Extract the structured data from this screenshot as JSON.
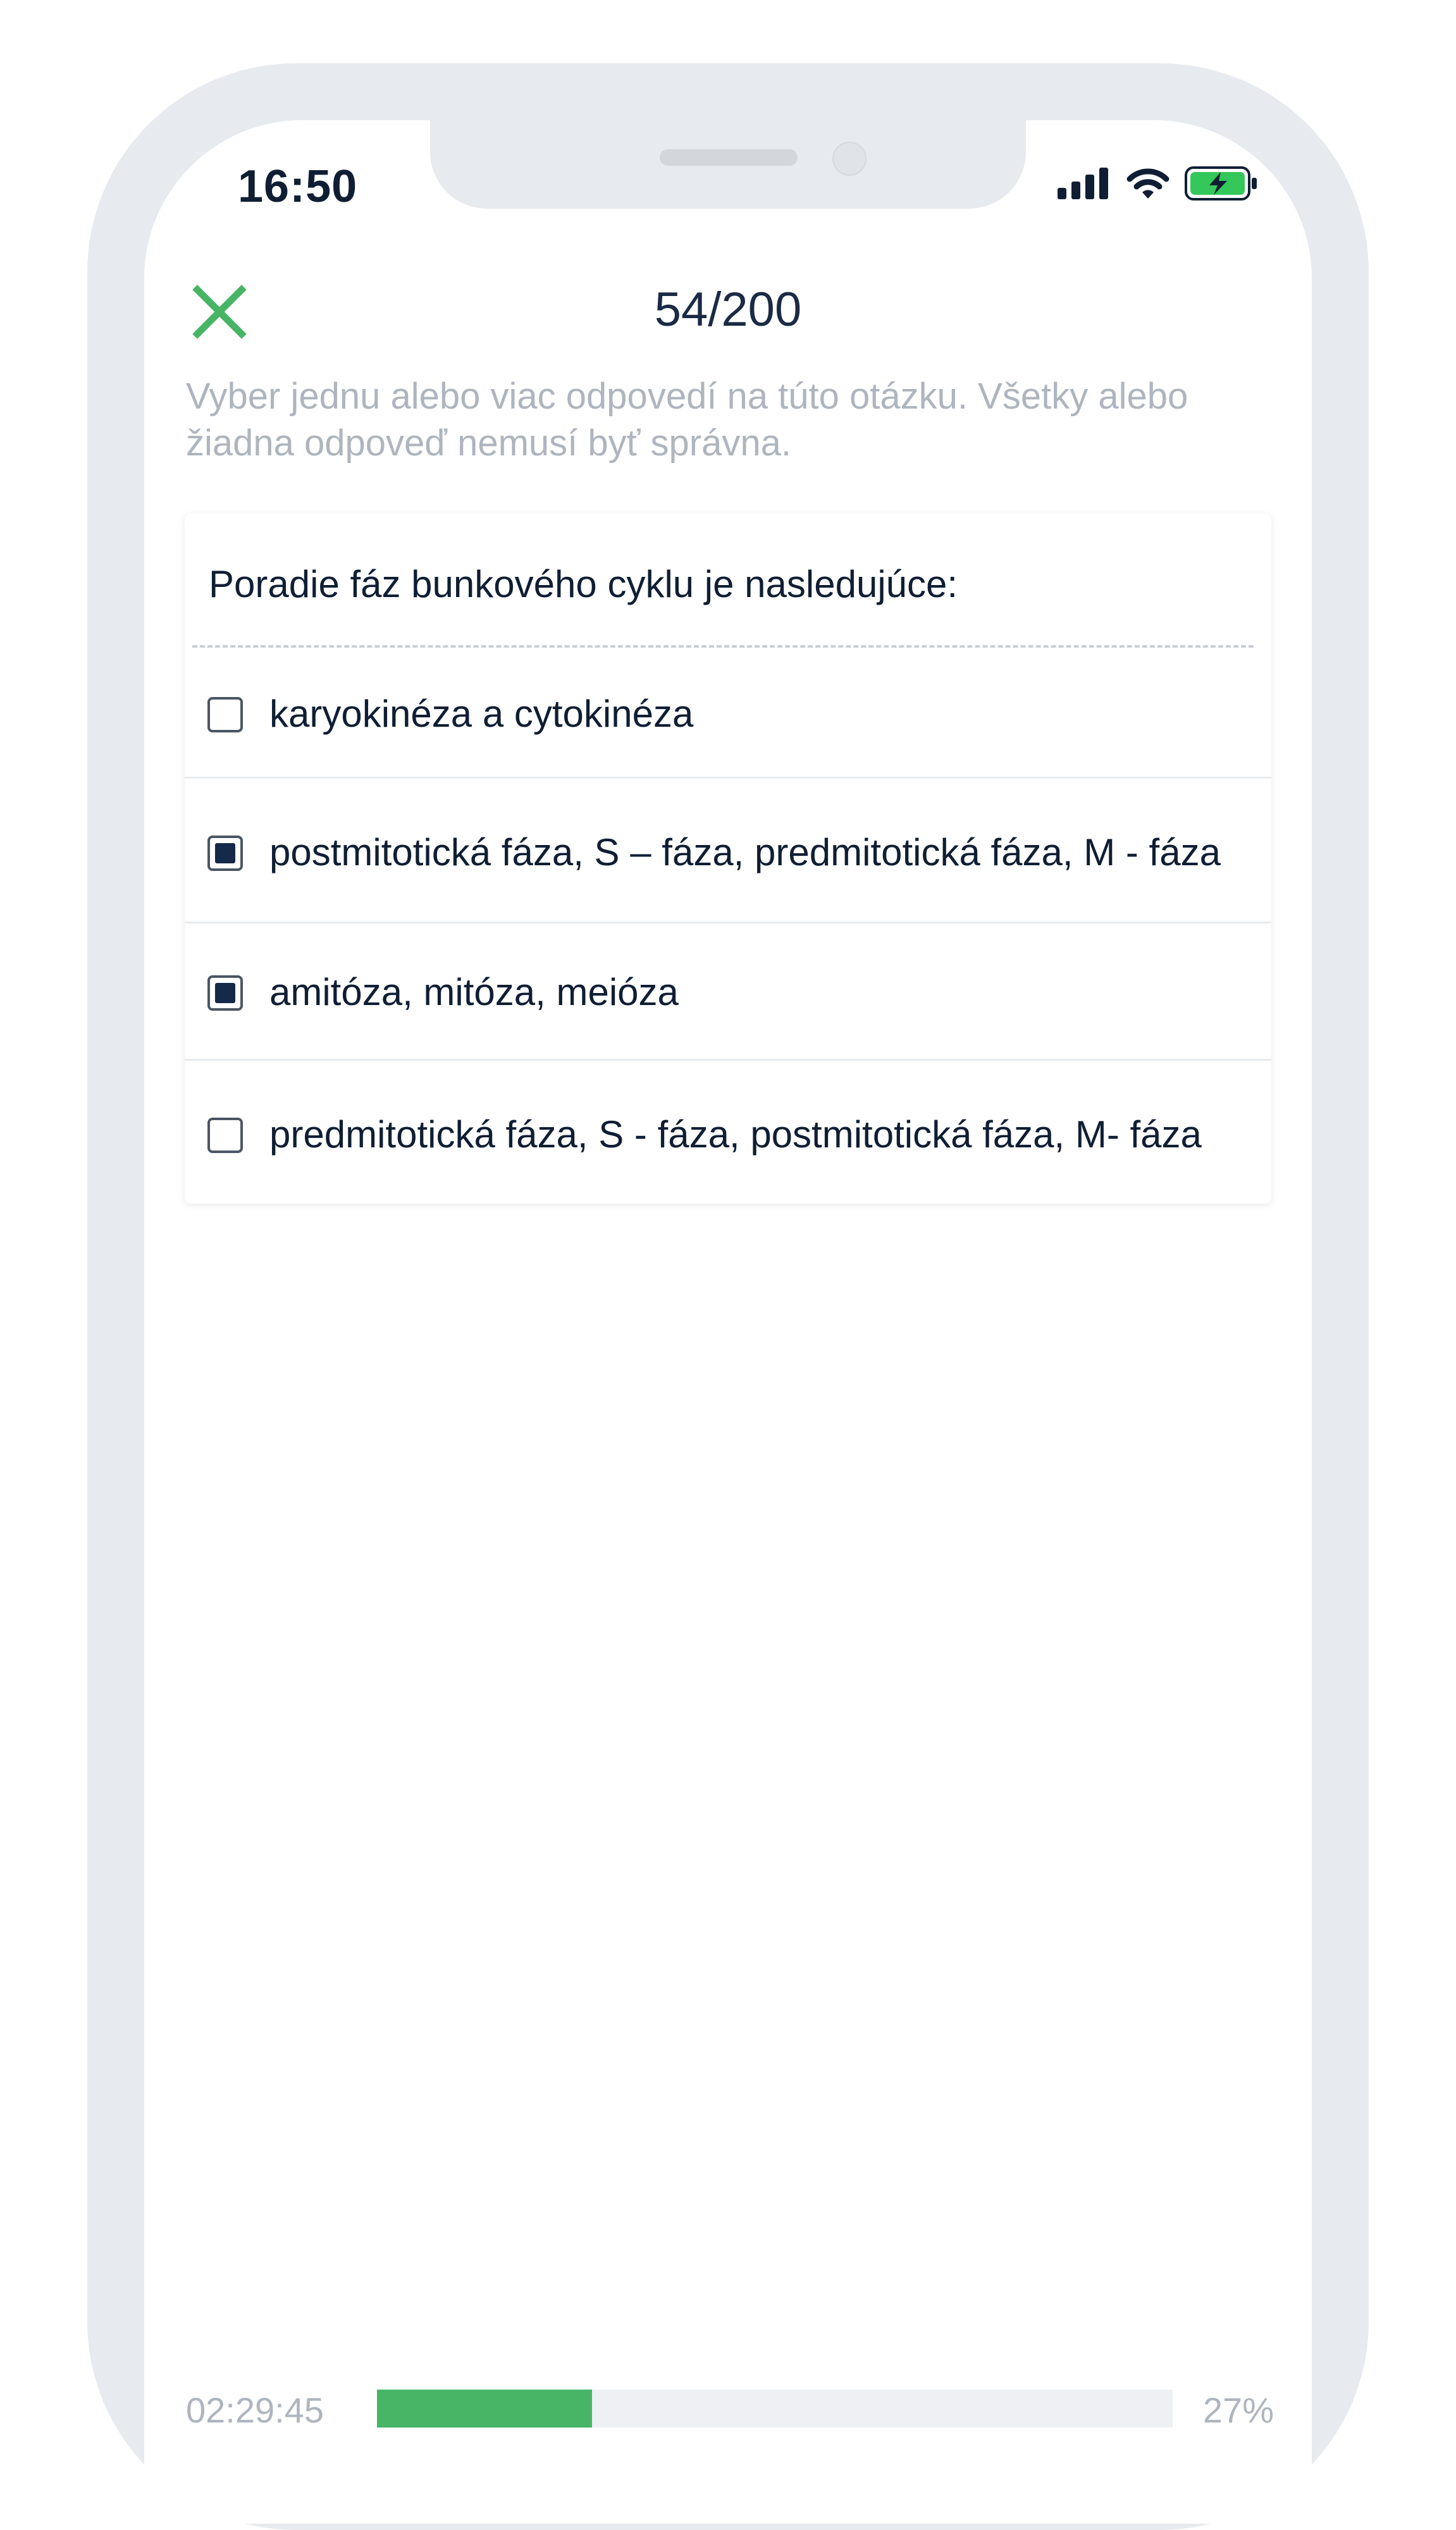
{
  "status_bar": {
    "time": "16:50",
    "icons": [
      "signal-icon",
      "wifi-icon",
      "battery-charging-icon"
    ],
    "battery_color": "#34c759"
  },
  "header": {
    "close_icon": "close-icon",
    "close_color": "#47b565",
    "counter": "54/200"
  },
  "instructions": "Vyber jednu alebo viac odpovedí na túto otázku. Všetky alebo žiadna odpoveď nemusí byť správna.",
  "question": "Poradie fáz bunkového cyklu je nasledujúce:",
  "options": [
    {
      "text": "karyokinéza a cytokinéza",
      "checked": false
    },
    {
      "text": "postmitotická fáza, S – fáza, predmitotická fáza, M - fáza",
      "checked": true
    },
    {
      "text": "amitóza, mitóza, meióza",
      "checked": true
    },
    {
      "text": "predmitotická fáza, S - fáza, postmitotická fáza, M- fáza",
      "checked": false
    }
  ],
  "footer": {
    "timer": "02:29:45",
    "progress_fraction": 0.27,
    "percent_label": "27%",
    "progress_color": "#47b565"
  }
}
